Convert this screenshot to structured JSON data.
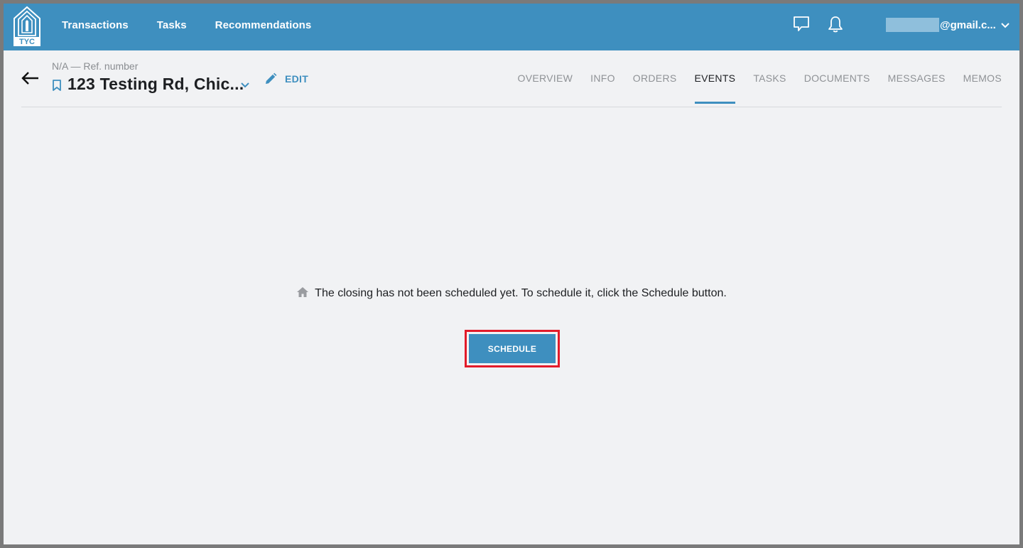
{
  "header": {
    "logo_text": "TYC",
    "nav": [
      "Transactions",
      "Tasks",
      "Recommendations"
    ],
    "user_email": "@gmail.c..."
  },
  "transaction": {
    "ref_label": "N/A — Ref. number",
    "address": "123 Testing Rd, Chic...",
    "edit_label": "EDIT"
  },
  "tabs": [
    "OVERVIEW",
    "INFO",
    "ORDERS",
    "EVENTS",
    "TASKS",
    "DOCUMENTS",
    "MESSAGES",
    "MEMOS"
  ],
  "active_tab": "EVENTS",
  "empty_state": {
    "message": "The closing has not been scheduled yet. To schedule it, click the Schedule button.",
    "button_label": "SCHEDULE"
  },
  "colors": {
    "brand": "#3e8fbf",
    "highlight": "#e21b2a"
  }
}
